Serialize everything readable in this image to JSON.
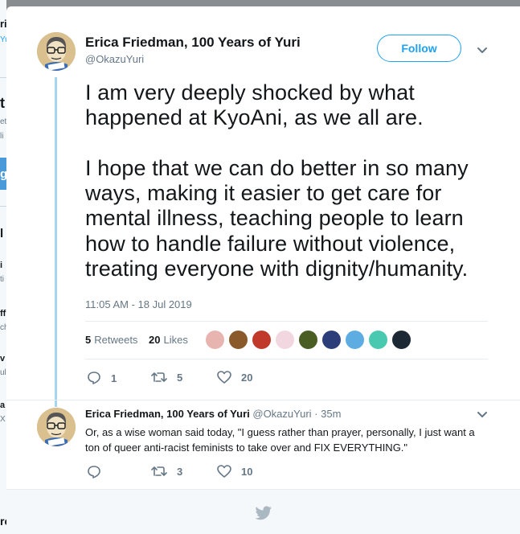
{
  "background_page": {
    "fragments": [
      "ri",
      "Yu",
      "t",
      "et",
      "li",
      "g",
      "l",
      "i",
      "ti",
      "ff",
      "ch",
      "v",
      "ul",
      "a",
      "X",
      "re"
    ]
  },
  "tweet": {
    "author_name": "Erica Friedman, 100 Years of Yuri",
    "author_handle": "@OkazuYuri",
    "follow_label": "Follow",
    "paragraphs": [
      "I am very deeply shocked by what happened at KyoAni, as we all are.",
      "I hope that we can do better in so many ways, making it easier to get care for mental illness, teaching people to learn how to handle failure without violence, treating everyone with dignity/humanity."
    ],
    "timestamp": "11:05 AM - 18 Jul 2019",
    "retweets_count": "5",
    "retweets_label": "Retweets",
    "likes_count": "20",
    "likes_label": "Likes",
    "liker_avatar_colors": [
      "#e8b4b0",
      "#8b5a2b",
      "#c0392b",
      "#f2d7e0",
      "#4a5d23",
      "#2c3e7a",
      "#5dade2",
      "#48c9b0",
      "#1c2833"
    ],
    "actions": {
      "replies": "1",
      "retweets": "5",
      "likes": "20"
    }
  },
  "reply": {
    "author_name": "Erica Friedman, 100 Years of Yuri",
    "author_handle": "@OkazuYuri",
    "separator": "·",
    "time": "35m",
    "text": "Or, as a wise woman said today, \"I guess rather than prayer, personally, I just want a ton of queer anti-racist feminists to take over and FIX EVERYTHING.\"",
    "actions": {
      "replies": "",
      "retweets": "3",
      "likes": "10"
    }
  },
  "colors": {
    "accent": "#1da1f2",
    "thread_line": "#a6d3ee",
    "secondary_text": "#657786"
  },
  "icons": {
    "avatar": "cartoon-avatar-icon",
    "reply": "reply-icon",
    "retweet": "retweet-icon",
    "like": "heart-icon",
    "dropdown": "chevron-down-icon",
    "footer": "twitter-bird-icon"
  }
}
